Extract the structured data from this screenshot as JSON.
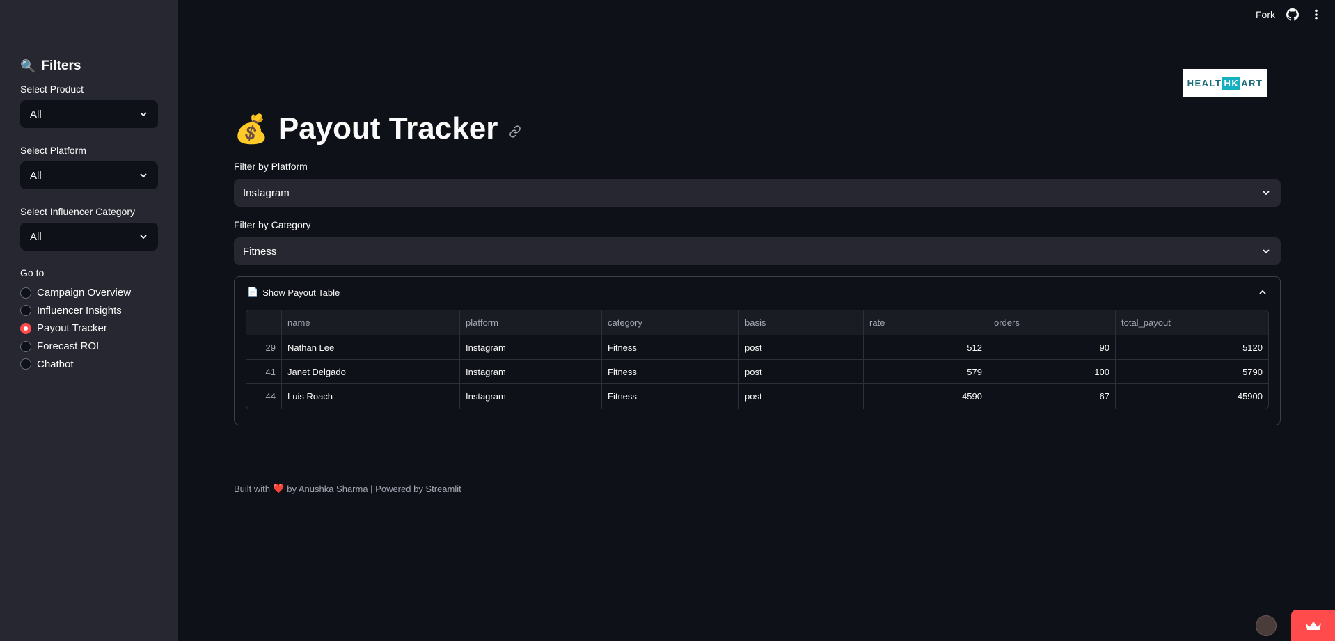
{
  "sidebar": {
    "title_emoji": "🔍",
    "title": "Filters",
    "selects": [
      {
        "label": "Select Product",
        "value": "All"
      },
      {
        "label": "Select Platform",
        "value": "All"
      },
      {
        "label": "Select Influencer Category",
        "value": "All"
      }
    ],
    "goto_label": "Go to",
    "nav": [
      {
        "label": "Campaign Overview",
        "selected": false
      },
      {
        "label": "Influencer Insights",
        "selected": false
      },
      {
        "label": "Payout Tracker",
        "selected": true
      },
      {
        "label": "Forecast ROI",
        "selected": false
      },
      {
        "label": "Chatbot",
        "selected": false
      }
    ]
  },
  "topbar": {
    "fork_label": "Fork",
    "github_icon": "github-icon",
    "menu_icon": "kebab-menu-icon"
  },
  "logo": {
    "left": "HEALT",
    "highlight": "HK",
    "right": "ART"
  },
  "page": {
    "title_emoji": "💰",
    "title": "Payout Tracker",
    "platform_filter": {
      "label": "Filter by Platform",
      "value": "Instagram"
    },
    "category_filter": {
      "label": "Filter by Category",
      "value": "Fitness"
    },
    "expander": {
      "icon": "📄",
      "label": "Show Payout Table"
    },
    "table": {
      "columns": [
        "",
        "name",
        "platform",
        "category",
        "basis",
        "rate",
        "orders",
        "total_payout"
      ],
      "rows": [
        [
          "29",
          "Nathan Lee",
          "Instagram",
          "Fitness",
          "post",
          "512",
          "90",
          "5120"
        ],
        [
          "41",
          "Janet Delgado",
          "Instagram",
          "Fitness",
          "post",
          "579",
          "100",
          "5790"
        ],
        [
          "44",
          "Luis Roach",
          "Instagram",
          "Fitness",
          "post",
          "4590",
          "67",
          "45900"
        ]
      ]
    },
    "footer": {
      "prefix": "Built with",
      "heart": "❤️",
      "suffix": "by Anushka Sharma | Powered by Streamlit"
    }
  },
  "colors": {
    "background": "#0e1117",
    "sidebar": "#262730",
    "accent": "#ff4b4b",
    "select_bg": "#262730"
  }
}
